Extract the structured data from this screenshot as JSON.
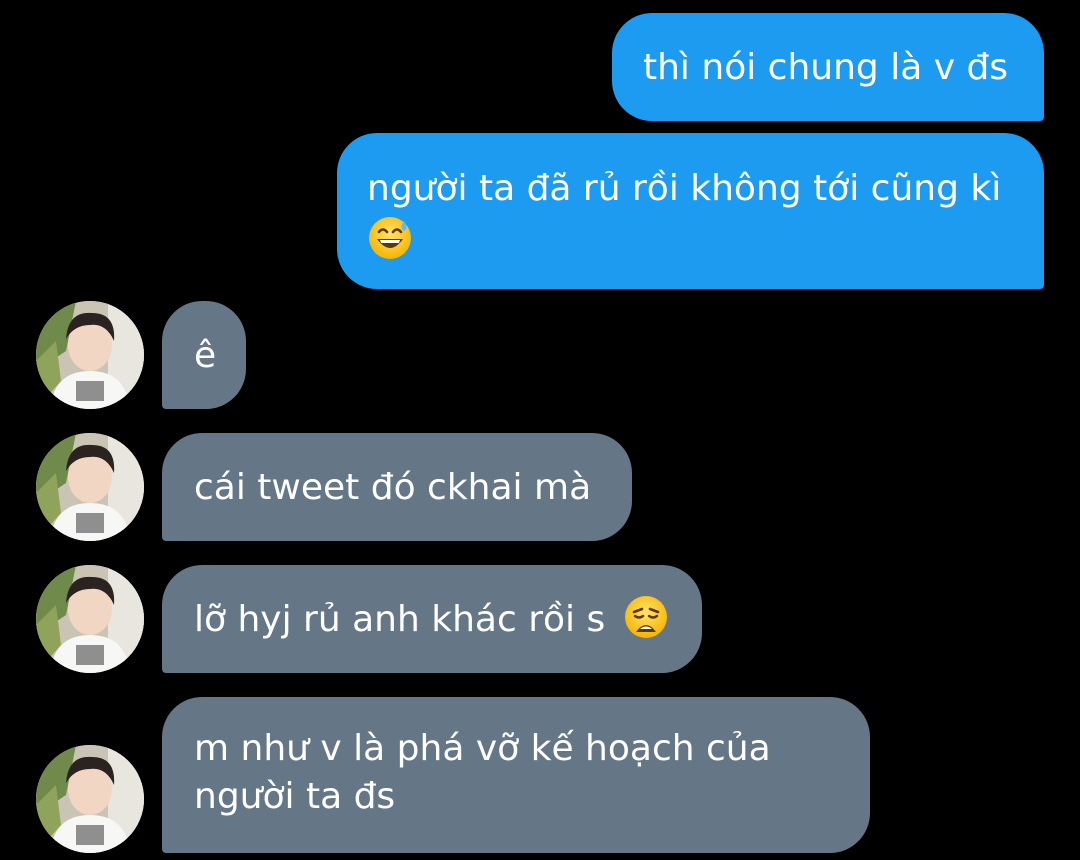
{
  "conversation": {
    "messages": [
      {
        "direction": "sent",
        "text": "thì nói chung là v đs"
      },
      {
        "direction": "sent",
        "text": "người ta đã rủ rồi không tới cũng kì",
        "emoji": "grinning-face-with-sweat-icon"
      },
      {
        "direction": "received",
        "text": "ê"
      },
      {
        "direction": "received",
        "text": "cái tweet đó ckhai mà"
      },
      {
        "direction": "received",
        "text": "lỡ hyj rủ anh khác rồi s",
        "emoji": "weary-face-icon"
      },
      {
        "direction": "received",
        "text_line1": "m như v là phá vỡ kế hoạch của",
        "text_line2": "người ta đs"
      }
    ]
  },
  "colors": {
    "background": "#000000",
    "sent_bubble": "#1d9bf0",
    "received_bubble": "#657786",
    "text": "#ffffff"
  }
}
